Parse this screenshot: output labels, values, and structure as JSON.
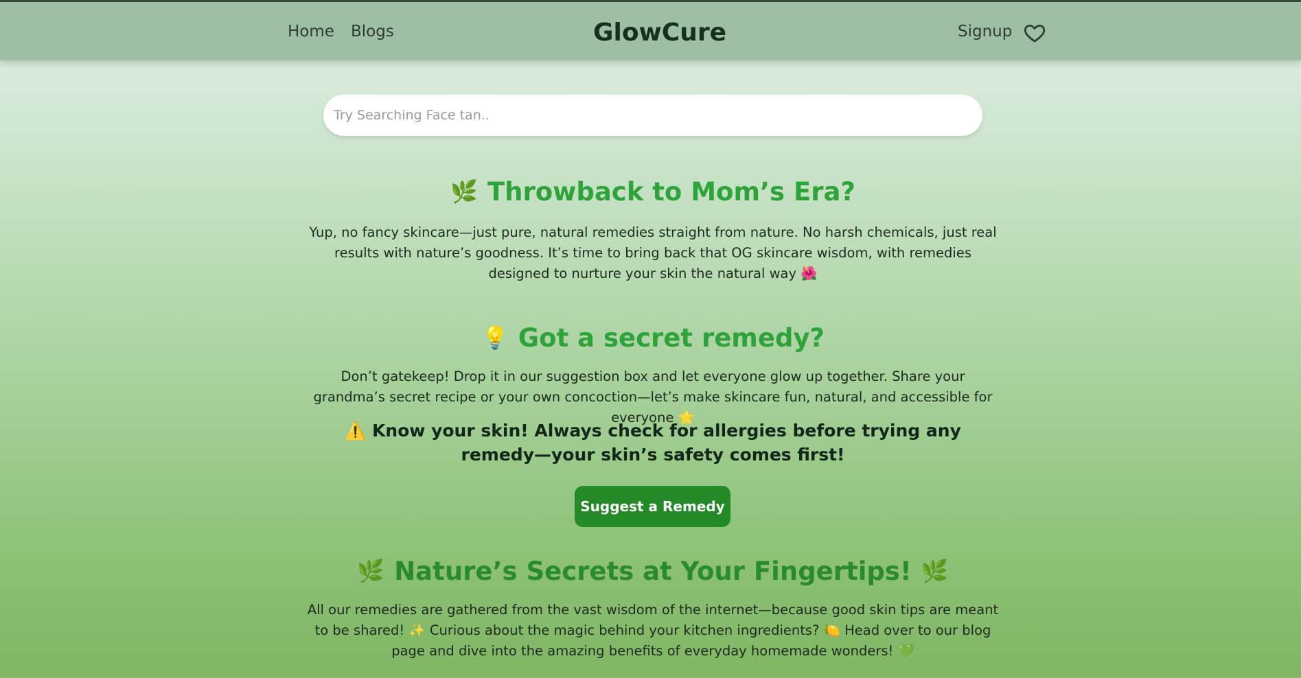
{
  "nav": {
    "home_label": "Home",
    "blogs_label": "Blogs",
    "brand": "GlowCure",
    "signup_label": "Signup",
    "wishlist_icon": "heart-icon"
  },
  "search": {
    "placeholder": "Try Searching Face tan.."
  },
  "section1": {
    "icon": "🌿",
    "title": "Throwback to Mom’s Era?",
    "text": "Yup, no fancy skincare—just pure, natural remedies straight from nature. No harsh chemicals, just real results with nature’s goodness. It’s time to bring back that OG skincare wisdom, with remedies designed to nurture your skin the natural way 🌺"
  },
  "section2": {
    "icon": "💡",
    "title": "Got a secret remedy?",
    "text": "Don’t gatekeep! Drop it in our suggestion box and let everyone glow up together. Share your grandma’s secret recipe or your own concoction—let’s make skincare fun, natural, and accessible for everyone 🌟",
    "warning": "⚠️ Know your skin! Always check for allergies before trying any remedy—your skin’s safety comes first!",
    "button_label": "Suggest a Remedy"
  },
  "section3": {
    "icon_left": "🌿",
    "icon_right": "🌿",
    "title": "Nature’s Secrets at Your Fingertips!",
    "text": "All our remedies are gathered from the vast wisdom of the internet—because good skin tips are meant to be shared! ✨ Curious about the magic behind your kitchen ingredients? 🍋 Head over to our blog page and dive into the amazing benefits of everyday homemade wonders! 💚"
  },
  "colors": {
    "navbar": "#9fbfa5",
    "heading_green": "#2ea33a",
    "button_green": "#238a27"
  }
}
